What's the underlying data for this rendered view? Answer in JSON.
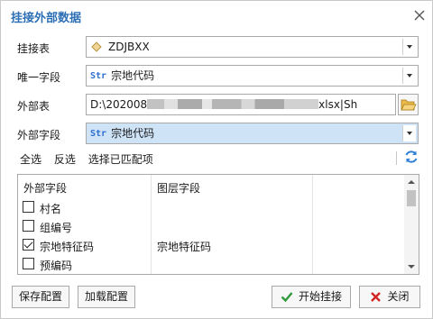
{
  "window": {
    "title": "挂接外部数据",
    "close_icon": "close-icon"
  },
  "form": {
    "mount_table": {
      "label": "挂接表",
      "value": "ZDJBXX",
      "icon": "layer-diamond-icon"
    },
    "unique_field": {
      "label": "唯一字段",
      "type_tag": "Str",
      "value": "宗地代码"
    },
    "external_table": {
      "label": "外部表",
      "path_prefix": "D:\\202008",
      "path_suffix": "xlsx|Sh",
      "browse_icon": "folder-open-icon"
    },
    "external_field": {
      "label": "外部字段",
      "type_tag": "Str",
      "value": "宗地代码"
    }
  },
  "selection_links": {
    "select_all": "全选",
    "invert": "反选",
    "select_matched": "选择已匹配项",
    "refresh_icon": "refresh-icon"
  },
  "grid": {
    "columns": [
      "外部字段",
      "图层字段"
    ],
    "rows": [
      {
        "name": "村名",
        "layer_field": "",
        "checked": false
      },
      {
        "name": "组编号",
        "layer_field": "",
        "checked": false
      },
      {
        "name": "宗地特征码",
        "layer_field": "宗地特征码",
        "checked": true
      },
      {
        "name": "预编码",
        "layer_field": "",
        "checked": false
      }
    ]
  },
  "buttons": {
    "save_config": "保存配置",
    "load_config": "加载配置",
    "start_mount": "开始挂接",
    "close": "关闭"
  },
  "colors": {
    "title": "#2d6fb5",
    "str_tag": "#2f6fd0",
    "selected_field": "#cfe3f7",
    "ok_icon": "#2e9b3a",
    "close_icon": "#d02424"
  }
}
